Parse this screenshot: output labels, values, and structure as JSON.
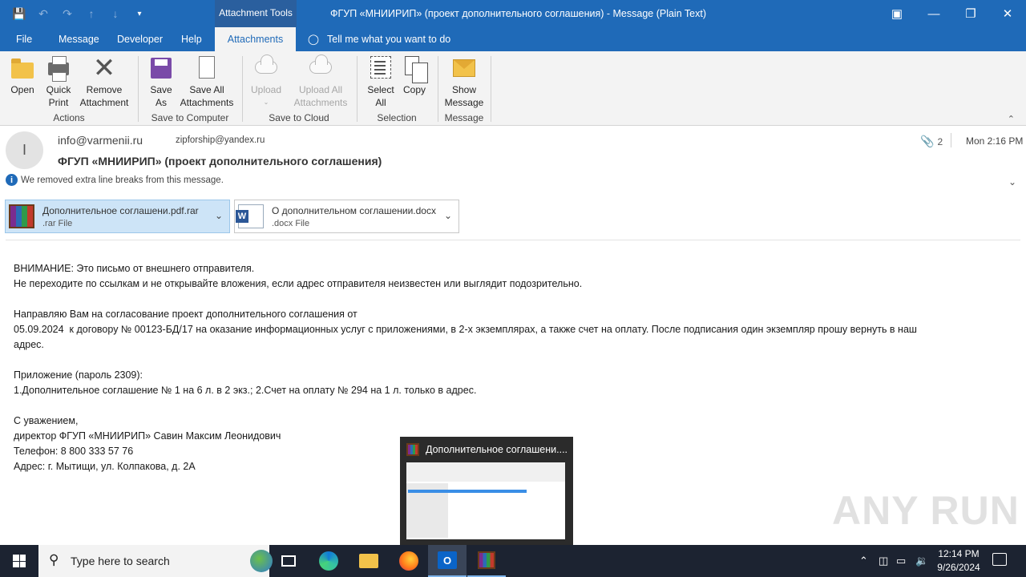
{
  "titlebar": {
    "context_tab": "Attachment Tools",
    "title": "ФГУП «МНИИРИП» (проект дополнительного соглашения)  -  Message (Plain Text)"
  },
  "tabs": [
    {
      "label": "File"
    },
    {
      "label": "Message"
    },
    {
      "label": "Developer"
    },
    {
      "label": "Help"
    },
    {
      "label": "Attachments"
    }
  ],
  "tell_me": "Tell me what you want to do",
  "ribbon": {
    "open": "Open",
    "quick_print": [
      "Quick",
      "Print"
    ],
    "remove_attachment": [
      "Remove",
      "Attachment"
    ],
    "save_as": [
      "Save",
      "As"
    ],
    "save_all": [
      "Save All",
      "Attachments"
    ],
    "upload": "Upload",
    "upload_all": [
      "Upload All",
      "Attachments"
    ],
    "select_all": [
      "Select",
      "All"
    ],
    "copy": "Copy",
    "show_message": [
      "Show",
      "Message"
    ],
    "groups": {
      "actions": "Actions",
      "save_to_computer": "Save to Computer",
      "save_to_cloud": "Save to Cloud",
      "selection": "Selection",
      "message": "Message"
    }
  },
  "message": {
    "avatar_initial": "I",
    "from": "info@varmenii.ru",
    "to": "zipforship@yandex.ru",
    "subject": "ФГУП «МНИИРИП» (проект дополнительного соглашения)",
    "attachment_count": "2",
    "date": "Mon 2:16 PM",
    "info_bar": "We removed extra line breaks from this message."
  },
  "attachments": [
    {
      "name": "Дополнительное соглашени.pdf.rar",
      "type": ".rar File"
    },
    {
      "name": "О дополнительном соглашении.docx",
      "type": ".docx File"
    }
  ],
  "body": [
    "ВНИМАНИЕ: Это письмо от внешнего отправителя.",
    "Не переходите по ссылкам и не открывайте вложения, если адрес отправителя неизвестен или выглядит подозрительно.",
    "",
    "Направляю Вам на согласование проект дополнительного соглашения от",
    "05.09.2024  к договору № 00123-БД/17 на оказание информационных услуг с приложениями, в 2-х экземплярах, а также счет на оплату. После подписания один экземпляр прошу вернуть в наш",
    "адрес.",
    "",
    "Приложение (пароль 2309):",
    "1.Дополнительное соглашение № 1 на 6 л. в 2 экз.; 2.Счет на оплату № 294 на 1 л. только в адрес.",
    "",
    "С уважением,",
    "директор ФГУП «МНИИРИП» Савин Максим Леонидович",
    "Телефон: 8 800 333 57 76",
    "Адрес: г. Мытищи, ул. Колпакова, д. 2А"
  ],
  "thumbnail": {
    "title": "Дополнительное соглашени...."
  },
  "watermark": "ANY RUN",
  "taskbar": {
    "search_placeholder": "Type here to search",
    "time": "12:14 PM",
    "date": "9/26/2024"
  }
}
